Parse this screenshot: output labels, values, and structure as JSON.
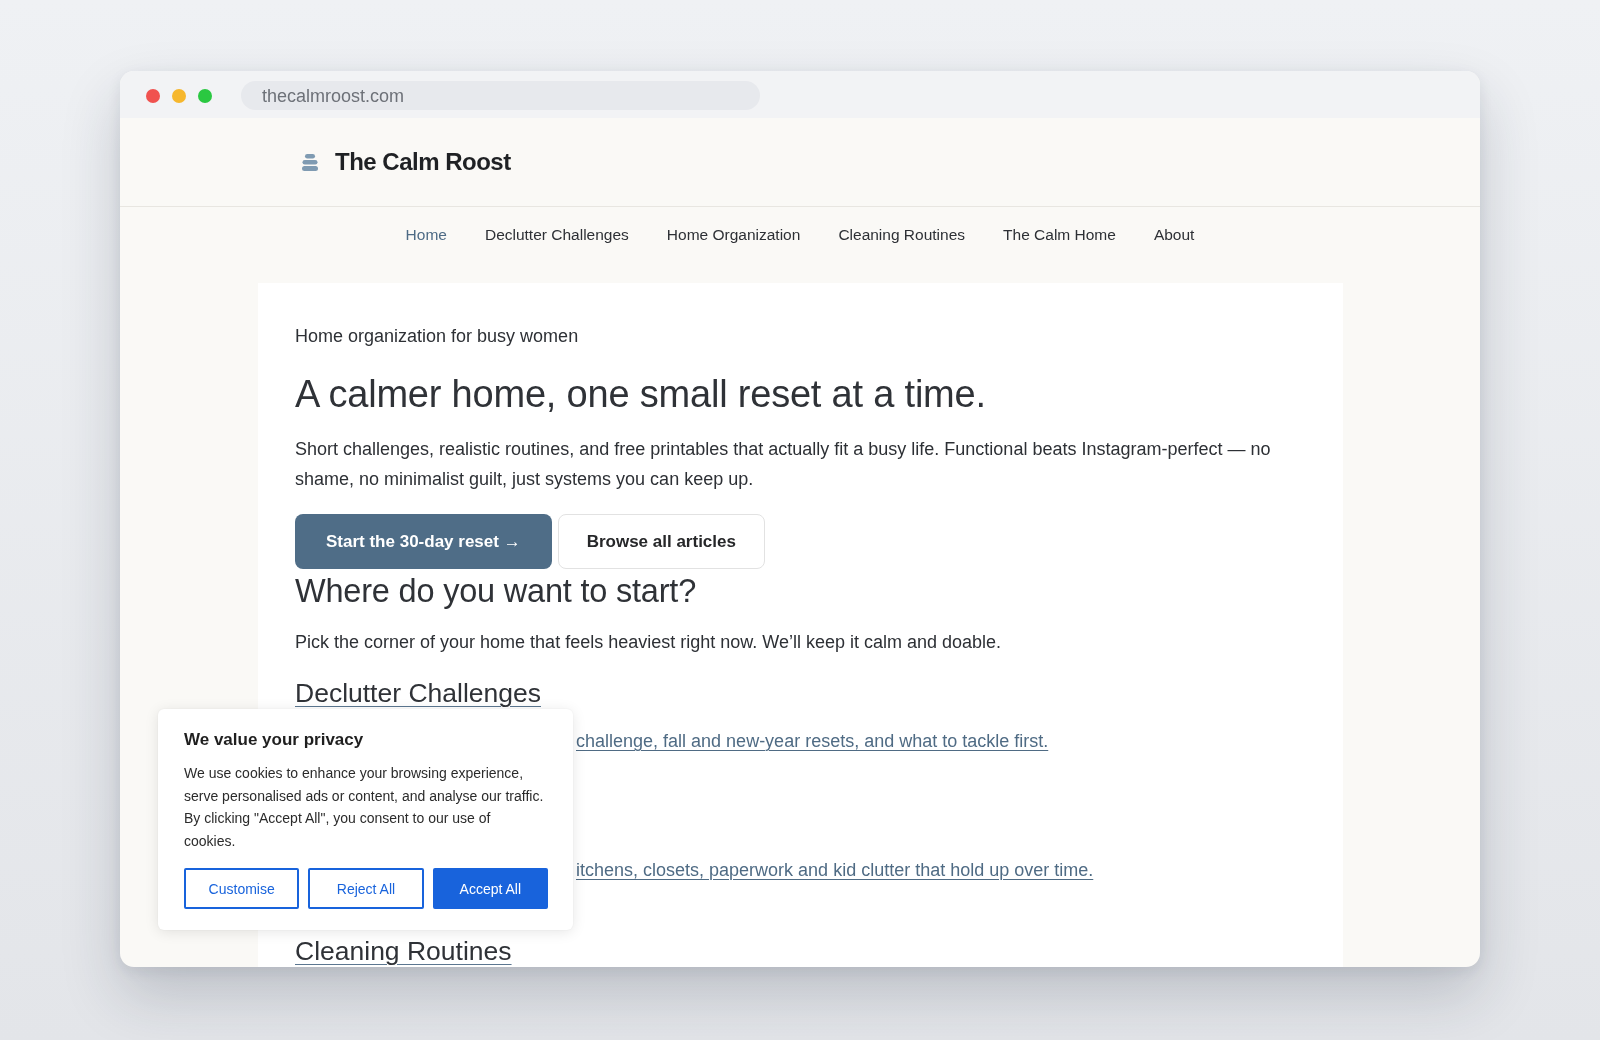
{
  "browser": {
    "url": "thecalmroost.com"
  },
  "header": {
    "site_title": "The Calm Roost"
  },
  "nav": [
    {
      "label": "Home",
      "selected": true
    },
    {
      "label": "Declutter Challenges",
      "selected": false
    },
    {
      "label": "Home Organization",
      "selected": false
    },
    {
      "label": "Cleaning Routines",
      "selected": false
    },
    {
      "label": "The Calm Home",
      "selected": false
    },
    {
      "label": "About",
      "selected": false
    }
  ],
  "hero": {
    "eyebrow": "Home organization for busy women",
    "title": "A calmer home, one small reset at a time.",
    "text": "Short challenges, realistic routines, and free printables that actually fit a busy life. Functional beats Instagram-perfect — no shame, no minimalist guilt, just systems you can keep up.",
    "buttons": [
      {
        "label": "Start the 30-day reset →",
        "kind": "primary"
      },
      {
        "label": "Browse all articles",
        "kind": "secondary"
      }
    ]
  },
  "topics": {
    "title": "Where do you want to start?",
    "intro": "Pick the corner of your home that feels heaviest right now. We’ll keep it calm and doable.",
    "items": [
      {
        "title": "Declutter Challenges",
        "description": "challenge, fall and new-year resets, and what to tackle first."
      },
      {
        "description": "itchens, closets, paperwork and kid clutter that hold up over time."
      },
      {
        "title": "Cleaning Routines"
      }
    ]
  },
  "cookie_banner": {
    "title": "We value your privacy",
    "text": "We use cookies to enhance your browsing experience, serve personalised ads or content, and analyse our traffic. By clicking \"Accept All\", you consent to our use of cookies.",
    "buttons": [
      {
        "label": "Customise",
        "kind": "outline"
      },
      {
        "label": "Reject All",
        "kind": "outline"
      },
      {
        "label": "Accept All",
        "kind": "filled"
      }
    ]
  }
}
